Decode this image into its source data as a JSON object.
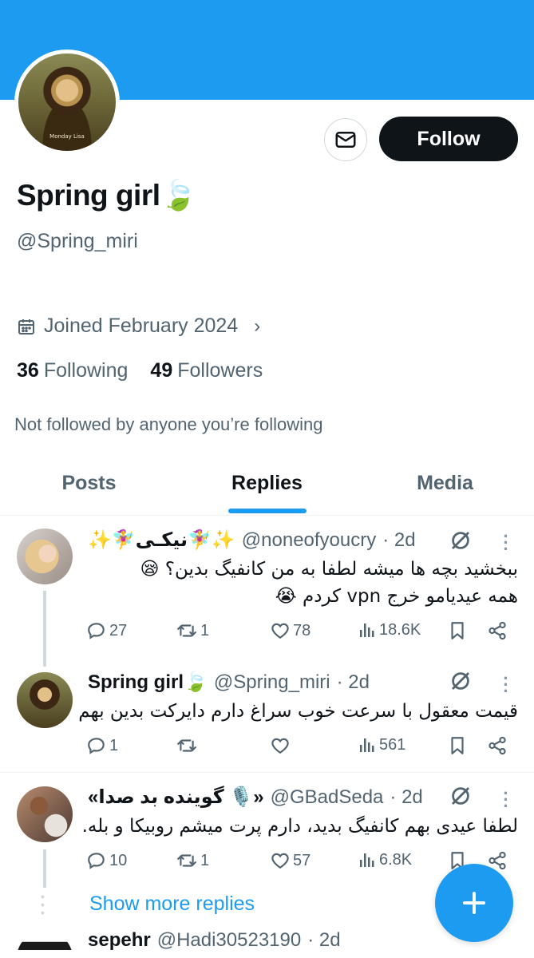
{
  "profile": {
    "display_name": "Spring girl🍃",
    "handle": "@Spring_miri",
    "avatar_caption": "Monday Lisa",
    "joined": "Joined February 2024",
    "following_count": "36",
    "following_label": "Following",
    "followers_count": "49",
    "followers_label": "Followers",
    "not_followed": "Not followed by anyone you’re following",
    "follow_label": "Follow"
  },
  "tabs": [
    {
      "label": "Posts",
      "active": false
    },
    {
      "label": "Replies",
      "active": true
    },
    {
      "label": "Media",
      "active": false
    }
  ],
  "posts": [
    {
      "name": "✨🧚‍♀️نیکـی🧚‍♀️✨",
      "handle": "@noneofyoucry",
      "time": "· 2d",
      "text_lines": [
        "ببخشید بچه ها میشه لطفا به من کانفیگ بدین؟ 😪",
        "همه عیدیامو خرج vpn کردم 😭"
      ],
      "replies": "27",
      "reposts": "1",
      "likes": "78",
      "views": "18.6K"
    },
    {
      "name": "Spring girl🍃",
      "handle": "@Spring_miri",
      "time": "· 2d",
      "text_lines": [
        "قیمت معقول با سرعت خوب سراغ دارم دایرکت بدین بهم"
      ],
      "replies": "1",
      "reposts": "",
      "likes": "",
      "views": "561"
    },
    {
      "name": "«گوینده بد صدا 🎙️»",
      "handle": "@GBadSeda",
      "time": "· 2d",
      "text_lines": [
        "لطفا عیدی بهم کانفیگ بدید، دارم پرت میشم روبیکا و بله."
      ],
      "replies": "10",
      "reposts": "1",
      "likes": "57",
      "views": "6.8K"
    },
    {
      "name": "sepehr",
      "handle": "@Hadi30523190",
      "time": "· 2d"
    }
  ],
  "show_more_replies": "Show more replies",
  "colors": {
    "accent": "#1d9bf0",
    "text": "#0f1419",
    "muted": "#536471"
  }
}
